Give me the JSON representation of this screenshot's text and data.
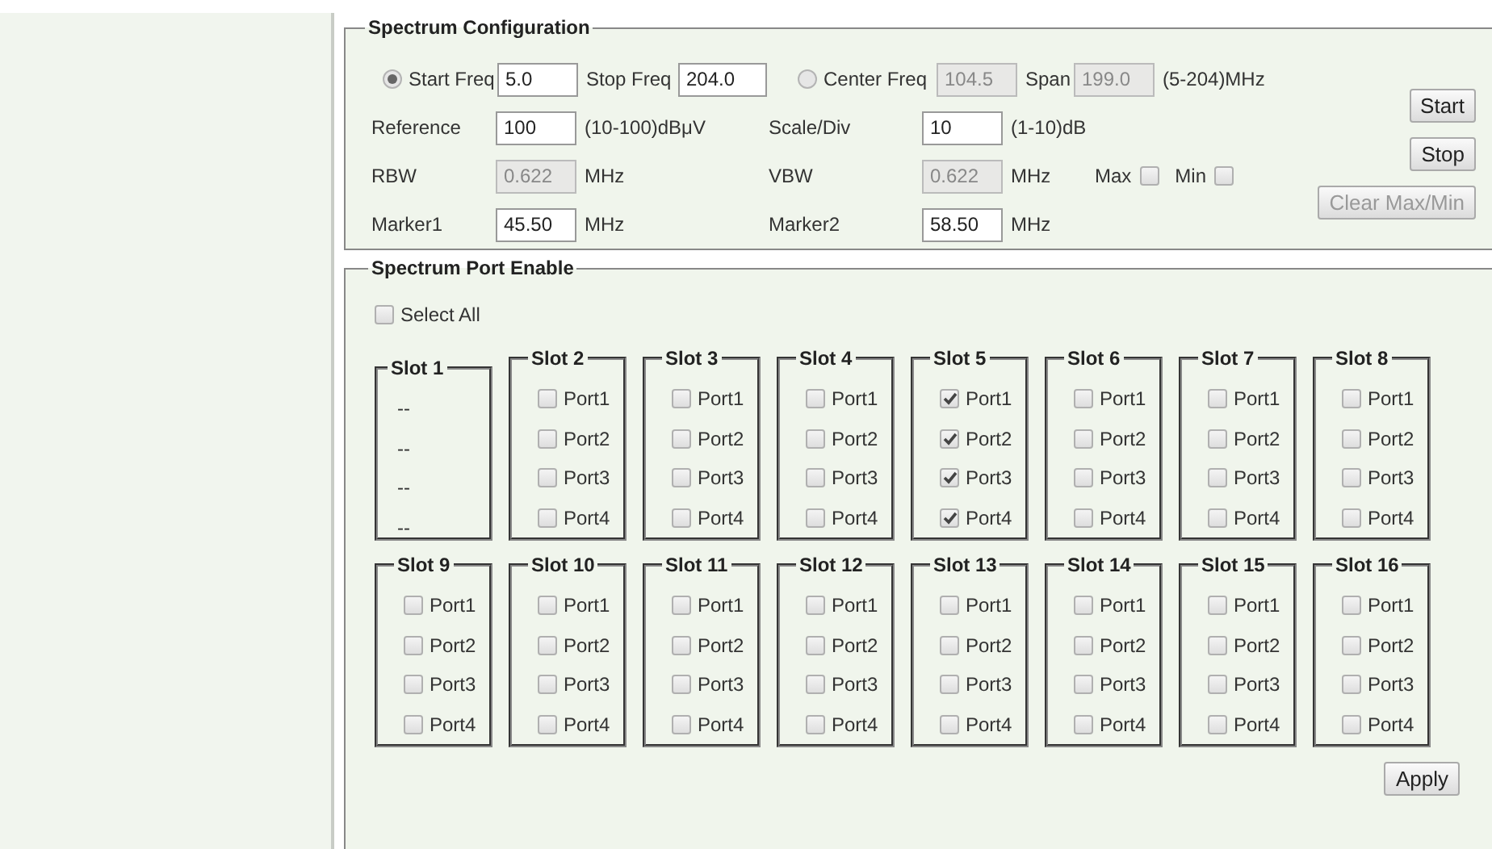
{
  "spectrum_configuration": {
    "legend": "Spectrum Configuration",
    "start_freq": {
      "label": "Start Freq",
      "value": "5.0",
      "selected": true
    },
    "stop_freq": {
      "label": "Stop Freq",
      "value": "204.0"
    },
    "center_freq": {
      "label": "Center Freq",
      "value": "104.5",
      "selected": false,
      "disabled": true
    },
    "span": {
      "label": "Span",
      "value": "199.0",
      "disabled": true
    },
    "freq_range": "(5-204)MHz",
    "reference": {
      "label": "Reference",
      "value": "100",
      "unit": "(10-100)dBμV",
      "disabled": false
    },
    "scale_div": {
      "label": "Scale/Div",
      "value": "10",
      "unit": "(1-10)dB",
      "disabled": false
    },
    "rbw": {
      "label": "RBW",
      "value": "0.622",
      "unit": "MHz",
      "disabled": true
    },
    "vbw": {
      "label": "VBW",
      "value": "0.622",
      "unit": "MHz",
      "disabled": true
    },
    "max": {
      "label": "Max",
      "checked": false
    },
    "min": {
      "label": "Min",
      "checked": false
    },
    "marker1": {
      "label": "Marker1",
      "value": "45.50",
      "unit": "MHz",
      "disabled": false
    },
    "marker2": {
      "label": "Marker2",
      "value": "58.50",
      "unit": "MHz",
      "disabled": false
    },
    "buttons": [
      {
        "label": "Start",
        "disabled": false
      },
      {
        "label": "Stop",
        "disabled": false
      },
      {
        "label": "Clear Max/Min",
        "disabled": true
      }
    ]
  },
  "spectrum_port_enable": {
    "legend": "Spectrum Port Enable",
    "select_all": {
      "label": "Select All",
      "checked": false
    },
    "slots": [
      {
        "title": "Slot 1",
        "kind": "empty",
        "entries": [
          "--",
          "--",
          "--",
          "--"
        ]
      },
      {
        "title": "Slot 2",
        "kind": "ports",
        "ports": [
          {
            "label": "Port1",
            "checked": false
          },
          {
            "label": "Port2",
            "checked": false
          },
          {
            "label": "Port3",
            "checked": false
          },
          {
            "label": "Port4",
            "checked": false
          }
        ]
      },
      {
        "title": "Slot 3",
        "kind": "ports",
        "ports": [
          {
            "label": "Port1",
            "checked": false
          },
          {
            "label": "Port2",
            "checked": false
          },
          {
            "label": "Port3",
            "checked": false
          },
          {
            "label": "Port4",
            "checked": false
          }
        ]
      },
      {
        "title": "Slot 4",
        "kind": "ports",
        "ports": [
          {
            "label": "Port1",
            "checked": false
          },
          {
            "label": "Port2",
            "checked": false
          },
          {
            "label": "Port3",
            "checked": false
          },
          {
            "label": "Port4",
            "checked": false
          }
        ]
      },
      {
        "title": "Slot 5",
        "kind": "ports",
        "ports": [
          {
            "label": "Port1",
            "checked": true
          },
          {
            "label": "Port2",
            "checked": true
          },
          {
            "label": "Port3",
            "checked": true
          },
          {
            "label": "Port4",
            "checked": true
          }
        ]
      },
      {
        "title": "Slot 6",
        "kind": "ports",
        "ports": [
          {
            "label": "Port1",
            "checked": false
          },
          {
            "label": "Port2",
            "checked": false
          },
          {
            "label": "Port3",
            "checked": false
          },
          {
            "label": "Port4",
            "checked": false
          }
        ]
      },
      {
        "title": "Slot 7",
        "kind": "ports",
        "ports": [
          {
            "label": "Port1",
            "checked": false
          },
          {
            "label": "Port2",
            "checked": false
          },
          {
            "label": "Port3",
            "checked": false
          },
          {
            "label": "Port4",
            "checked": false
          }
        ]
      },
      {
        "title": "Slot 8",
        "kind": "ports",
        "ports": [
          {
            "label": "Port1",
            "checked": false
          },
          {
            "label": "Port2",
            "checked": false
          },
          {
            "label": "Port3",
            "checked": false
          },
          {
            "label": "Port4",
            "checked": false
          }
        ]
      },
      {
        "title": "Slot 9",
        "kind": "ports",
        "ports": [
          {
            "label": "Port1",
            "checked": false
          },
          {
            "label": "Port2",
            "checked": false
          },
          {
            "label": "Port3",
            "checked": false
          },
          {
            "label": "Port4",
            "checked": false
          }
        ]
      },
      {
        "title": "Slot 10",
        "kind": "ports",
        "ports": [
          {
            "label": "Port1",
            "checked": false
          },
          {
            "label": "Port2",
            "checked": false
          },
          {
            "label": "Port3",
            "checked": false
          },
          {
            "label": "Port4",
            "checked": false
          }
        ]
      },
      {
        "title": "Slot 11",
        "kind": "ports",
        "ports": [
          {
            "label": "Port1",
            "checked": false
          },
          {
            "label": "Port2",
            "checked": false
          },
          {
            "label": "Port3",
            "checked": false
          },
          {
            "label": "Port4",
            "checked": false
          }
        ]
      },
      {
        "title": "Slot 12",
        "kind": "ports",
        "ports": [
          {
            "label": "Port1",
            "checked": false
          },
          {
            "label": "Port2",
            "checked": false
          },
          {
            "label": "Port3",
            "checked": false
          },
          {
            "label": "Port4",
            "checked": false
          }
        ]
      },
      {
        "title": "Slot 13",
        "kind": "ports",
        "ports": [
          {
            "label": "Port1",
            "checked": false
          },
          {
            "label": "Port2",
            "checked": false
          },
          {
            "label": "Port3",
            "checked": false
          },
          {
            "label": "Port4",
            "checked": false
          }
        ]
      },
      {
        "title": "Slot 14",
        "kind": "ports",
        "ports": [
          {
            "label": "Port1",
            "checked": false
          },
          {
            "label": "Port2",
            "checked": false
          },
          {
            "label": "Port3",
            "checked": false
          },
          {
            "label": "Port4",
            "checked": false
          }
        ]
      },
      {
        "title": "Slot 15",
        "kind": "ports",
        "ports": [
          {
            "label": "Port1",
            "checked": false
          },
          {
            "label": "Port2",
            "checked": false
          },
          {
            "label": "Port3",
            "checked": false
          },
          {
            "label": "Port4",
            "checked": false
          }
        ]
      },
      {
        "title": "Slot 16",
        "kind": "ports",
        "ports": [
          {
            "label": "Port1",
            "checked": false
          },
          {
            "label": "Port2",
            "checked": false
          },
          {
            "label": "Port3",
            "checked": false
          },
          {
            "label": "Port4",
            "checked": false
          }
        ]
      }
    ],
    "apply_button": "Apply"
  }
}
